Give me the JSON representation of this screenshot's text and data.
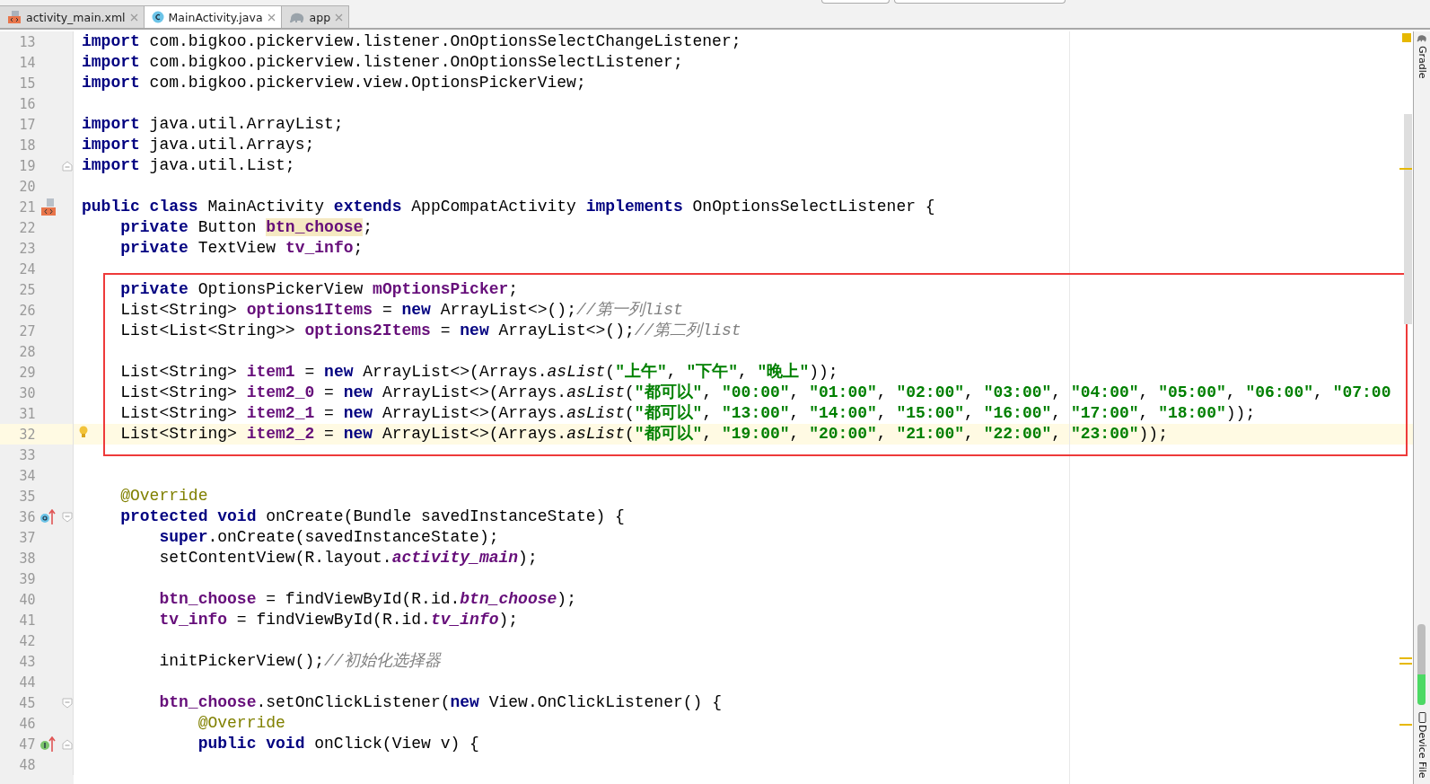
{
  "tabs": [
    {
      "label": "activity_main.xml",
      "kind": "xml",
      "selected": false
    },
    {
      "label": "MainActivity.java",
      "kind": "java",
      "selected": true
    },
    {
      "label": "app",
      "kind": "gradle",
      "selected": false
    }
  ],
  "editor": {
    "lines": [
      {
        "number": "13",
        "tokens": [
          {
            "kind": "kw",
            "text": "import"
          },
          {
            "kind": "plain",
            "text": " com.bigkoo.pickerview.listener.OnOptionsSelectChangeListener;"
          }
        ]
      },
      {
        "number": "14",
        "tokens": [
          {
            "kind": "kw",
            "text": "import"
          },
          {
            "kind": "plain",
            "text": " com.bigkoo.pickerview.listener.OnOptionsSelectListener;"
          }
        ]
      },
      {
        "number": "15",
        "tokens": [
          {
            "kind": "kw",
            "text": "import"
          },
          {
            "kind": "plain",
            "text": " com.bigkoo.pickerview.view.OptionsPickerView;"
          }
        ]
      },
      {
        "number": "16"
      },
      {
        "number": "17",
        "tokens": [
          {
            "kind": "kw",
            "text": "import"
          },
          {
            "kind": "plain",
            "text": " java.util.ArrayList;"
          }
        ]
      },
      {
        "number": "18",
        "tokens": [
          {
            "kind": "kw",
            "text": "import"
          },
          {
            "kind": "plain",
            "text": " java.util.Arrays;"
          }
        ]
      },
      {
        "number": "19",
        "fold_end": true,
        "tokens": [
          {
            "kind": "kw",
            "text": "import"
          },
          {
            "kind": "plain",
            "text": " java.util.List;"
          }
        ]
      },
      {
        "number": "20"
      },
      {
        "number": "21",
        "layout_marker": true,
        "tokens": [
          {
            "kind": "kw",
            "text": "public class"
          },
          {
            "kind": "plain",
            "text": " MainActivity "
          },
          {
            "kind": "kw",
            "text": "extends"
          },
          {
            "kind": "plain",
            "text": " AppCompatActivity "
          },
          {
            "kind": "kw",
            "text": "implements"
          },
          {
            "kind": "plain",
            "text": " OnOptionsSelectListener {"
          }
        ]
      },
      {
        "number": "22",
        "tokens": [
          {
            "kind": "kw",
            "text": "    private"
          },
          {
            "kind": "plain",
            "text": " Button "
          },
          {
            "kind": "field_usage",
            "text": "btn_choose"
          },
          {
            "kind": "plain",
            "text": ";"
          }
        ]
      },
      {
        "number": "23",
        "tokens": [
          {
            "kind": "kw",
            "text": "    private"
          },
          {
            "kind": "plain",
            "text": " TextView "
          },
          {
            "kind": "field",
            "text": "tv_info"
          },
          {
            "kind": "plain",
            "text": ";"
          }
        ]
      },
      {
        "number": "24"
      },
      {
        "number": "25",
        "tokens": [
          {
            "kind": "kw",
            "text": "    private"
          },
          {
            "kind": "plain",
            "text": " OptionsPickerView "
          },
          {
            "kind": "field",
            "text": "mOptionsPicker"
          },
          {
            "kind": "plain",
            "text": ";"
          }
        ]
      },
      {
        "number": "26",
        "tokens": [
          {
            "kind": "plain",
            "text": "    List<String> "
          },
          {
            "kind": "field",
            "text": "options1Items"
          },
          {
            "kind": "plain",
            "text": " = "
          },
          {
            "kind": "kw",
            "text": "new"
          },
          {
            "kind": "plain",
            "text": " ArrayList<>();"
          },
          {
            "kind": "comment",
            "text": "//第一列list"
          }
        ]
      },
      {
        "number": "27",
        "tokens": [
          {
            "kind": "plain",
            "text": "    List<List<String>> "
          },
          {
            "kind": "field",
            "text": "options2Items"
          },
          {
            "kind": "plain",
            "text": " = "
          },
          {
            "kind": "kw",
            "text": "new"
          },
          {
            "kind": "plain",
            "text": " ArrayList<>();"
          },
          {
            "kind": "comment",
            "text": "//第二列list"
          }
        ]
      },
      {
        "number": "28"
      },
      {
        "number": "29",
        "tokens": [
          {
            "kind": "plain",
            "text": "    List<String> "
          },
          {
            "kind": "field",
            "text": "item1"
          },
          {
            "kind": "plain",
            "text": " = "
          },
          {
            "kind": "kw",
            "text": "new"
          },
          {
            "kind": "plain",
            "text": " ArrayList<>(Arrays."
          },
          {
            "kind": "italic",
            "text": "asList"
          },
          {
            "kind": "plain",
            "text": "("
          },
          {
            "kind": "str",
            "text": "\"上午\""
          },
          {
            "kind": "plain",
            "text": ", "
          },
          {
            "kind": "str",
            "text": "\"下午\""
          },
          {
            "kind": "plain",
            "text": ", "
          },
          {
            "kind": "str",
            "text": "\"晚上\""
          },
          {
            "kind": "plain",
            "text": "));"
          }
        ]
      },
      {
        "number": "30",
        "tokens": [
          {
            "kind": "plain",
            "text": "    List<String> "
          },
          {
            "kind": "field",
            "text": "item2_0"
          },
          {
            "kind": "plain",
            "text": " = "
          },
          {
            "kind": "kw",
            "text": "new"
          },
          {
            "kind": "plain",
            "text": " ArrayList<>(Arrays."
          },
          {
            "kind": "italic",
            "text": "asList"
          },
          {
            "kind": "plain",
            "text": "("
          },
          {
            "kind": "str",
            "text": "\"都可以\""
          },
          {
            "kind": "plain",
            "text": ", "
          },
          {
            "kind": "str",
            "text": "\"00:00\""
          },
          {
            "kind": "plain",
            "text": ", "
          },
          {
            "kind": "str",
            "text": "\"01:00\""
          },
          {
            "kind": "plain",
            "text": ", "
          },
          {
            "kind": "str",
            "text": "\"02:00\""
          },
          {
            "kind": "plain",
            "text": ", "
          },
          {
            "kind": "str",
            "text": "\"03:00\""
          },
          {
            "kind": "plain",
            "text": ", "
          },
          {
            "kind": "str",
            "text": "\"04:00\""
          },
          {
            "kind": "plain",
            "text": ", "
          },
          {
            "kind": "str",
            "text": "\"05:00\""
          },
          {
            "kind": "plain",
            "text": ", "
          },
          {
            "kind": "str",
            "text": "\"06:00\""
          },
          {
            "kind": "plain",
            "text": ", "
          },
          {
            "kind": "str",
            "text": "\"07:00"
          }
        ]
      },
      {
        "number": "31",
        "tokens": [
          {
            "kind": "plain",
            "text": "    List<String> "
          },
          {
            "kind": "field",
            "text": "item2_1"
          },
          {
            "kind": "plain",
            "text": " = "
          },
          {
            "kind": "kw",
            "text": "new"
          },
          {
            "kind": "plain",
            "text": " ArrayList<>(Arrays."
          },
          {
            "kind": "italic",
            "text": "asList"
          },
          {
            "kind": "plain",
            "text": "("
          },
          {
            "kind": "str",
            "text": "\"都可以\""
          },
          {
            "kind": "plain",
            "text": ", "
          },
          {
            "kind": "str",
            "text": "\"13:00\""
          },
          {
            "kind": "plain",
            "text": ", "
          },
          {
            "kind": "str",
            "text": "\"14:00\""
          },
          {
            "kind": "plain",
            "text": ", "
          },
          {
            "kind": "str",
            "text": "\"15:00\""
          },
          {
            "kind": "plain",
            "text": ", "
          },
          {
            "kind": "str",
            "text": "\"16:00\""
          },
          {
            "kind": "plain",
            "text": ", "
          },
          {
            "kind": "str",
            "text": "\"17:00\""
          },
          {
            "kind": "plain",
            "text": ", "
          },
          {
            "kind": "str",
            "text": "\"18:00\""
          },
          {
            "kind": "plain",
            "text": "));"
          }
        ]
      },
      {
        "number": "32",
        "current": true,
        "intention_bulb": true,
        "tokens": [
          {
            "kind": "plain",
            "text": "    List<String> "
          },
          {
            "kind": "field",
            "text": "item2_2"
          },
          {
            "kind": "plain",
            "text": " = "
          },
          {
            "kind": "kw",
            "text": "new"
          },
          {
            "kind": "plain",
            "text": " ArrayList<>(Arrays."
          },
          {
            "kind": "italic",
            "text": "asList"
          },
          {
            "kind": "plain",
            "text": "("
          },
          {
            "kind": "str",
            "text": "\"都可以\""
          },
          {
            "kind": "plain",
            "text": ", "
          },
          {
            "kind": "str",
            "text": "\"19:00\""
          },
          {
            "kind": "plain",
            "text": ", "
          },
          {
            "kind": "str",
            "text": "\"20:00\""
          },
          {
            "kind": "plain",
            "text": ", "
          },
          {
            "kind": "str",
            "text": "\"21:00\""
          },
          {
            "kind": "plain",
            "text": ", "
          },
          {
            "kind": "str",
            "text": "\"22:00\""
          },
          {
            "kind": "plain",
            "text": ", "
          },
          {
            "kind": "str",
            "text": "\"23:00\""
          },
          {
            "kind": "plain",
            "text": "));"
          }
        ]
      },
      {
        "number": "33"
      },
      {
        "number": "34"
      },
      {
        "number": "35",
        "tokens": [
          {
            "kind": "anno",
            "text": "    @Override"
          }
        ]
      },
      {
        "number": "36",
        "override_marker": true,
        "fold_start": true,
        "tokens": [
          {
            "kind": "kw",
            "text": "    protected void"
          },
          {
            "kind": "plain",
            "text": " onCreate(Bundle savedInstanceState) {"
          }
        ]
      },
      {
        "number": "37",
        "tokens": [
          {
            "kind": "kw",
            "text": "        super"
          },
          {
            "kind": "plain",
            "text": ".onCreate(savedInstanceState);"
          }
        ]
      },
      {
        "number": "38",
        "tokens": [
          {
            "kind": "plain",
            "text": "        setContentView(R.layout."
          },
          {
            "kind": "static",
            "text": "activity_main"
          },
          {
            "kind": "plain",
            "text": ");"
          }
        ]
      },
      {
        "number": "39"
      },
      {
        "number": "40",
        "tokens": [
          {
            "kind": "field",
            "text": "        btn_choose"
          },
          {
            "kind": "plain",
            "text": " = findViewById(R.id."
          },
          {
            "kind": "static",
            "text": "btn_choose"
          },
          {
            "kind": "plain",
            "text": ");"
          }
        ]
      },
      {
        "number": "41",
        "tokens": [
          {
            "kind": "field",
            "text": "        tv_info"
          },
          {
            "kind": "plain",
            "text": " = findViewById(R.id."
          },
          {
            "kind": "static",
            "text": "tv_info"
          },
          {
            "kind": "plain",
            "text": ");"
          }
        ]
      },
      {
        "number": "42"
      },
      {
        "number": "43",
        "tokens": [
          {
            "kind": "plain",
            "text": "        initPickerView();"
          },
          {
            "kind": "comment",
            "text": "//初始化选择器"
          }
        ]
      },
      {
        "number": "44"
      },
      {
        "number": "45",
        "fold_start": true,
        "tokens": [
          {
            "kind": "field",
            "text": "        btn_choose"
          },
          {
            "kind": "plain",
            "text": ".setOnClickListener("
          },
          {
            "kind": "kw",
            "text": "new"
          },
          {
            "kind": "plain",
            "text": " View.OnClickListener() {"
          }
        ]
      },
      {
        "number": "46",
        "tokens": [
          {
            "kind": "anno",
            "text": "            @Override"
          }
        ]
      },
      {
        "number": "47",
        "implement_marker": true,
        "fold_end": true,
        "tokens": [
          {
            "kind": "kw",
            "text": "            public void"
          },
          {
            "kind": "plain",
            "text": " onClick(View v) {"
          }
        ]
      },
      {
        "number": "48"
      }
    ]
  },
  "tool_strip": {
    "top": "Gradle",
    "bottom": "Device File"
  }
}
